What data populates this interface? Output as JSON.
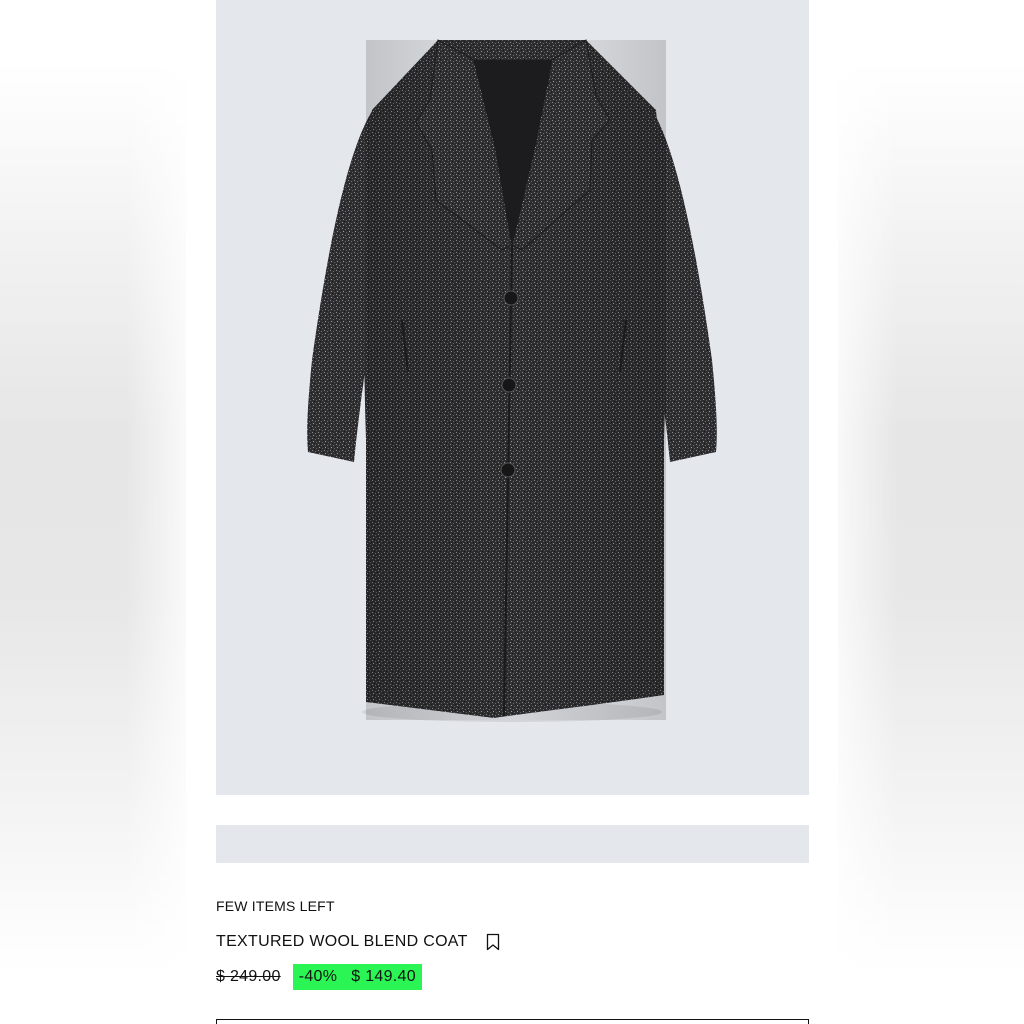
{
  "product": {
    "stock_status": "FEW ITEMS LEFT",
    "title": "TEXTURED WOOL BLEND COAT",
    "original_price": "$ 249.00",
    "discount": "-40%",
    "sale_price": "$ 149.40",
    "image_subject": "coat-photo",
    "bookmark_icon": "bookmark-icon"
  },
  "colors": {
    "sale_tag_background": "#2bf554",
    "image_background": "#e4e7eb"
  }
}
